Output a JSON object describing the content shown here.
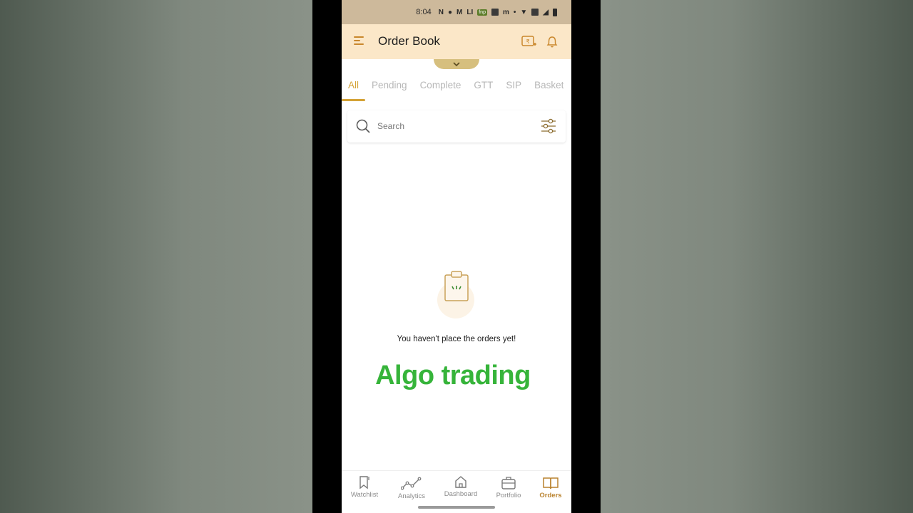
{
  "status_bar": {
    "time": "8:04"
  },
  "header": {
    "title": "Order Book"
  },
  "tabs": [
    {
      "label": "All",
      "active": true
    },
    {
      "label": "Pending",
      "active": false
    },
    {
      "label": "Complete",
      "active": false
    },
    {
      "label": "GTT",
      "active": false
    },
    {
      "label": "SIP",
      "active": false
    },
    {
      "label": "Basket",
      "active": false
    }
  ],
  "search": {
    "placeholder": "Search"
  },
  "empty_state": {
    "message": "You haven't place the orders yet!"
  },
  "overlay": {
    "caption": "Algo trading"
  },
  "bottom_nav": [
    {
      "label": "Watchlist",
      "icon": "bookmark-icon",
      "active": false
    },
    {
      "label": "Analytics",
      "icon": "analytics-icon",
      "active": false
    },
    {
      "label": "Dashboard",
      "icon": "home-icon",
      "active": false
    },
    {
      "label": "Portfolio",
      "icon": "briefcase-icon",
      "active": false
    },
    {
      "label": "Orders",
      "icon": "book-icon",
      "active": true
    }
  ],
  "colors": {
    "accent": "#d4a236",
    "header_bg": "#fbe7c8",
    "overlay_text": "#36b43a"
  }
}
